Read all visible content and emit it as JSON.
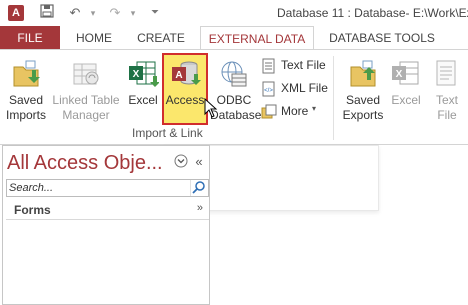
{
  "window": {
    "title": "Database 11 : Database- E:\\Work\\Exc",
    "app_icon_letter": "A"
  },
  "tabs": [
    {
      "label": "FILE"
    },
    {
      "label": "HOME"
    },
    {
      "label": "CREATE"
    },
    {
      "label": "EXTERNAL DATA",
      "active": true
    },
    {
      "label": "DATABASE TOOLS"
    }
  ],
  "ribbon": {
    "import_link": {
      "group_label": "Import & Link",
      "saved_imports": {
        "line1": "Saved",
        "line2": "Imports"
      },
      "linked_table_manager": {
        "line1": "Linked Table",
        "line2": "Manager"
      },
      "excel": {
        "label": "Excel"
      },
      "access": {
        "label": "Access"
      },
      "odbc": {
        "line1": "ODBC",
        "line2": "Database"
      },
      "text_file": {
        "label": "Text File"
      },
      "xml_file": {
        "label": "XML File"
      },
      "more": {
        "label": "More"
      }
    },
    "export": {
      "saved_exports": {
        "line1": "Saved",
        "line2": "Exports"
      },
      "excel": {
        "label": "Excel"
      },
      "text_file": {
        "line1": "Text",
        "line2": "File"
      }
    }
  },
  "nav_pane": {
    "title": "All Access Obje...",
    "search_placeholder": "Search...",
    "group": "Forms"
  },
  "colors": {
    "accent": "#a4373a",
    "highlight": "#fbe76c",
    "highlight_border": "#d12d2d",
    "excel_green": "#1e7145"
  }
}
